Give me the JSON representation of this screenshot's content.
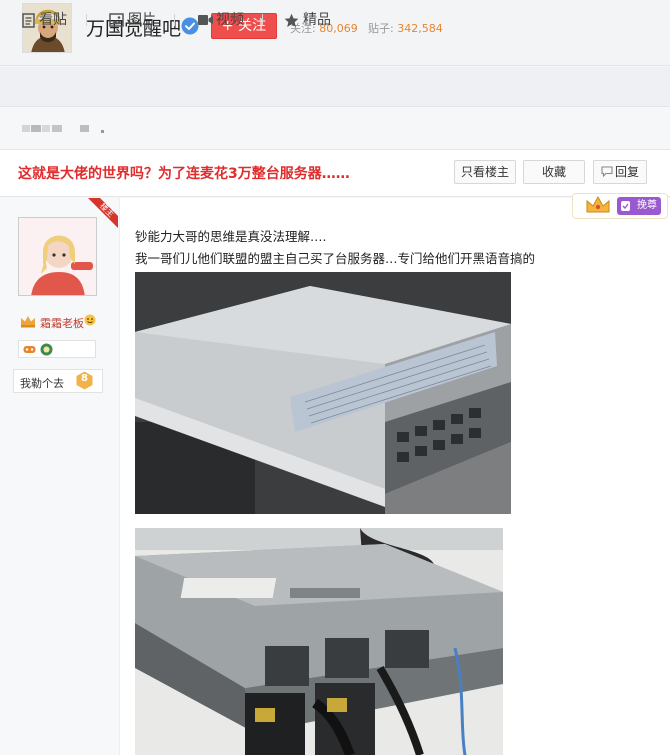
{
  "forum": {
    "name": "万国觉醒吧",
    "follow_label": "+ 关注",
    "followers_label": "关注:",
    "followers_count": "80,069",
    "posts_label": "贴子:",
    "posts_count": "342,584"
  },
  "nav": {
    "tabs": [
      {
        "label": "看贴",
        "icon": "document-icon"
      },
      {
        "label": "图片",
        "icon": "image-icon"
      },
      {
        "label": "视频",
        "icon": "video-camera-icon"
      },
      {
        "label": "精品",
        "icon": "star-icon"
      }
    ]
  },
  "thread": {
    "title": "这就是大佬的世界吗？为了连麦花3万整台服务器……",
    "actions": {
      "only_op": "只看楼主",
      "favorite": "收藏",
      "reply": "回复"
    }
  },
  "post": {
    "op_tag": "楼主",
    "save_tag": "挽尊",
    "author": {
      "name": "霜霜老板",
      "level_name": "我勒个去",
      "level": "8"
    },
    "lines": [
      "钞能力大哥的思维是真没法理解….",
      "我一哥们儿他们联盟的盟主自己买了台服务器…专门给他们开黑语音搞的"
    ]
  },
  "colors": {
    "title_red": "#e02c2c",
    "follow_button": "#ef4f4c",
    "stat_number": "#e8862e",
    "save_tag": "#9b59d0"
  }
}
